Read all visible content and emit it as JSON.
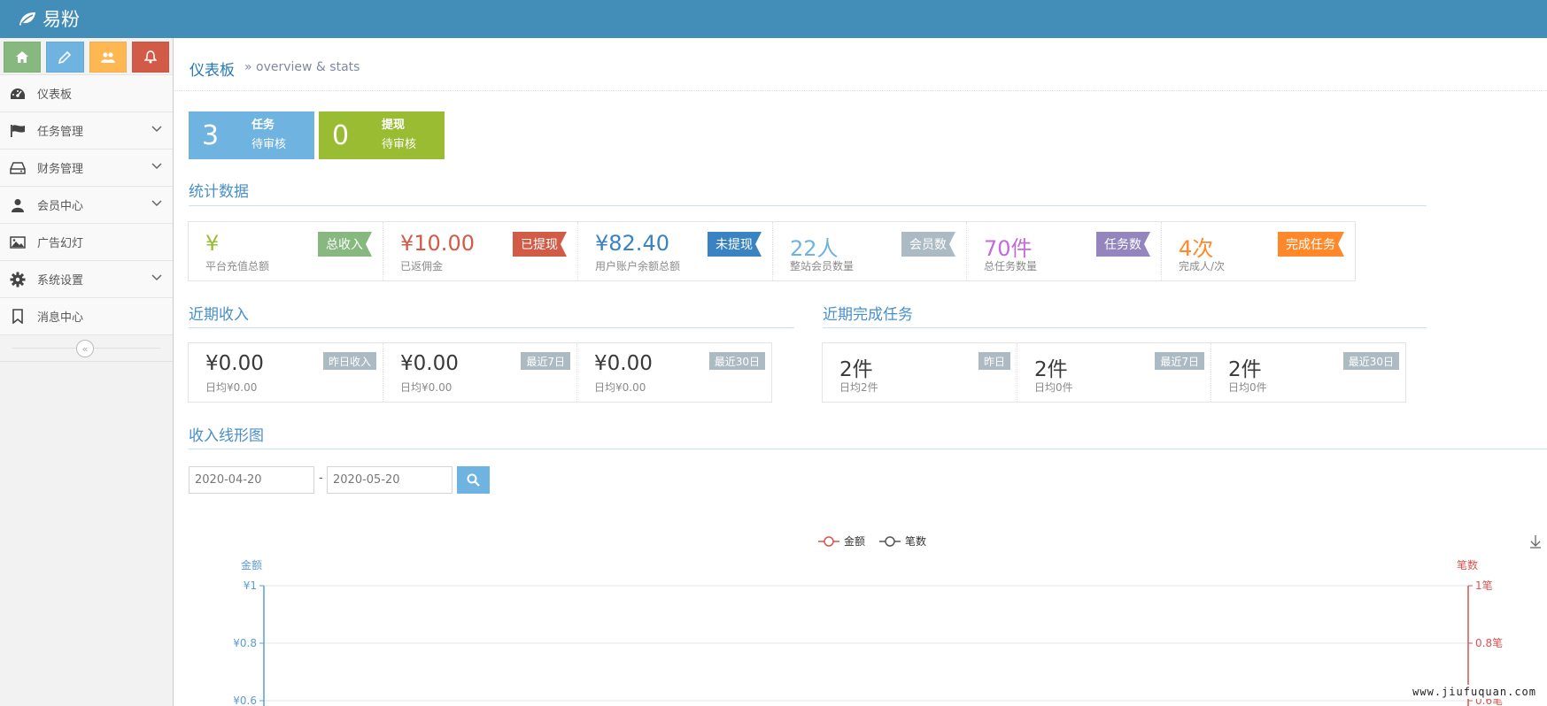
{
  "app": {
    "brand": "易粉"
  },
  "sidebar": {
    "shortcuts": [
      {
        "icon": "home-icon",
        "color": "#87b87f"
      },
      {
        "icon": "pencil-icon",
        "color": "#6fb3e0"
      },
      {
        "icon": "users-icon",
        "color": "#ffb752"
      },
      {
        "icon": "bell-icon",
        "color": "#d15b47"
      }
    ],
    "items": [
      {
        "label": "仪表板",
        "icon": "dashboard-icon",
        "expandable": false
      },
      {
        "label": "任务管理",
        "icon": "flag-icon",
        "expandable": true
      },
      {
        "label": "财务管理",
        "icon": "hdd-icon",
        "expandable": true
      },
      {
        "label": "会员中心",
        "icon": "user-icon",
        "expandable": true
      },
      {
        "label": "广告幻灯",
        "icon": "picture-icon",
        "expandable": false
      },
      {
        "label": "系统设置",
        "icon": "cog-icon",
        "expandable": true
      },
      {
        "label": "消息中心",
        "icon": "bookmark-icon",
        "expandable": false
      }
    ],
    "collapse_symbol": "«"
  },
  "header": {
    "title": "仪表板",
    "subtitle": "» overview & stats"
  },
  "pending": [
    {
      "count": "3",
      "line1": "任务",
      "line2": "待审核",
      "color": "#6fb3e0"
    },
    {
      "count": "0",
      "line1": "提现",
      "line2": "待审核",
      "color": "#9abc32"
    }
  ],
  "stats": {
    "title": "统计数据",
    "boxes": [
      {
        "value": "¥",
        "label": "平台充值总额",
        "badge": "总收入",
        "value_color": "#9abc32",
        "badge_color": "#87b87f"
      },
      {
        "value": "¥10.00",
        "label": "已返佣金",
        "badge": "已提现",
        "value_color": "#d15b47",
        "badge_color": "#d15b47"
      },
      {
        "value": "¥82.40",
        "label": "用户账户余额总额",
        "badge": "未提现",
        "value_color": "#3983c2",
        "badge_color": "#3983c2"
      },
      {
        "value": "22人",
        "label": "整站会员数量",
        "badge": "会员数",
        "value_color": "#6fb3e0",
        "badge_color": "#abbac3"
      },
      {
        "value": "70件",
        "label": "总任务数量",
        "badge": "任务数",
        "value_color": "#c36bd9",
        "badge_color": "#9585bf"
      },
      {
        "value": "4次",
        "label": "完成人/次",
        "badge": "完成任务",
        "value_color": "#ff892a",
        "badge_color": "#ff892a"
      }
    ]
  },
  "income": {
    "title": "近期收入",
    "boxes": [
      {
        "value": "¥0.00",
        "label": "日均¥0.00",
        "badge": "昨日收入"
      },
      {
        "value": "¥0.00",
        "label": "日均¥0.00",
        "badge": "最近7日"
      },
      {
        "value": "¥0.00",
        "label": "日均¥0.00",
        "badge": "最近30日"
      }
    ]
  },
  "tasks": {
    "title": "近期完成任务",
    "boxes": [
      {
        "value": "2件",
        "label": "日均2件",
        "badge": "昨日"
      },
      {
        "value": "2件",
        "label": "日均0件",
        "badge": "最近7日"
      },
      {
        "value": "2件",
        "label": "日均0件",
        "badge": "最近30日"
      }
    ]
  },
  "line_chart_section": {
    "title": "收入线形图",
    "date_from": "2020-04-20",
    "date_to": "2020-05-20",
    "separator": "-"
  },
  "chart_data": {
    "type": "line",
    "legend": [
      "金额",
      "笔数"
    ],
    "legend_placement": "top-center",
    "left_axis": {
      "label": "金额",
      "ticks": [
        "¥1",
        "¥0.8",
        "¥0.6"
      ],
      "tick_values": [
        1,
        0.8,
        0.6
      ],
      "color": "#5b9bd5"
    },
    "right_axis": {
      "label": "笔数",
      "ticks": [
        "1笔",
        "0.8笔",
        "0.6笔"
      ],
      "tick_values": [
        1,
        0.8,
        0.6
      ],
      "color": "#d9534f"
    },
    "series": [
      {
        "name": "金额",
        "color": "#d9534f",
        "values": []
      },
      {
        "name": "笔数",
        "color": "#555555",
        "values": []
      }
    ],
    "grid": true
  },
  "watermark": "www.jiufuquan.com"
}
